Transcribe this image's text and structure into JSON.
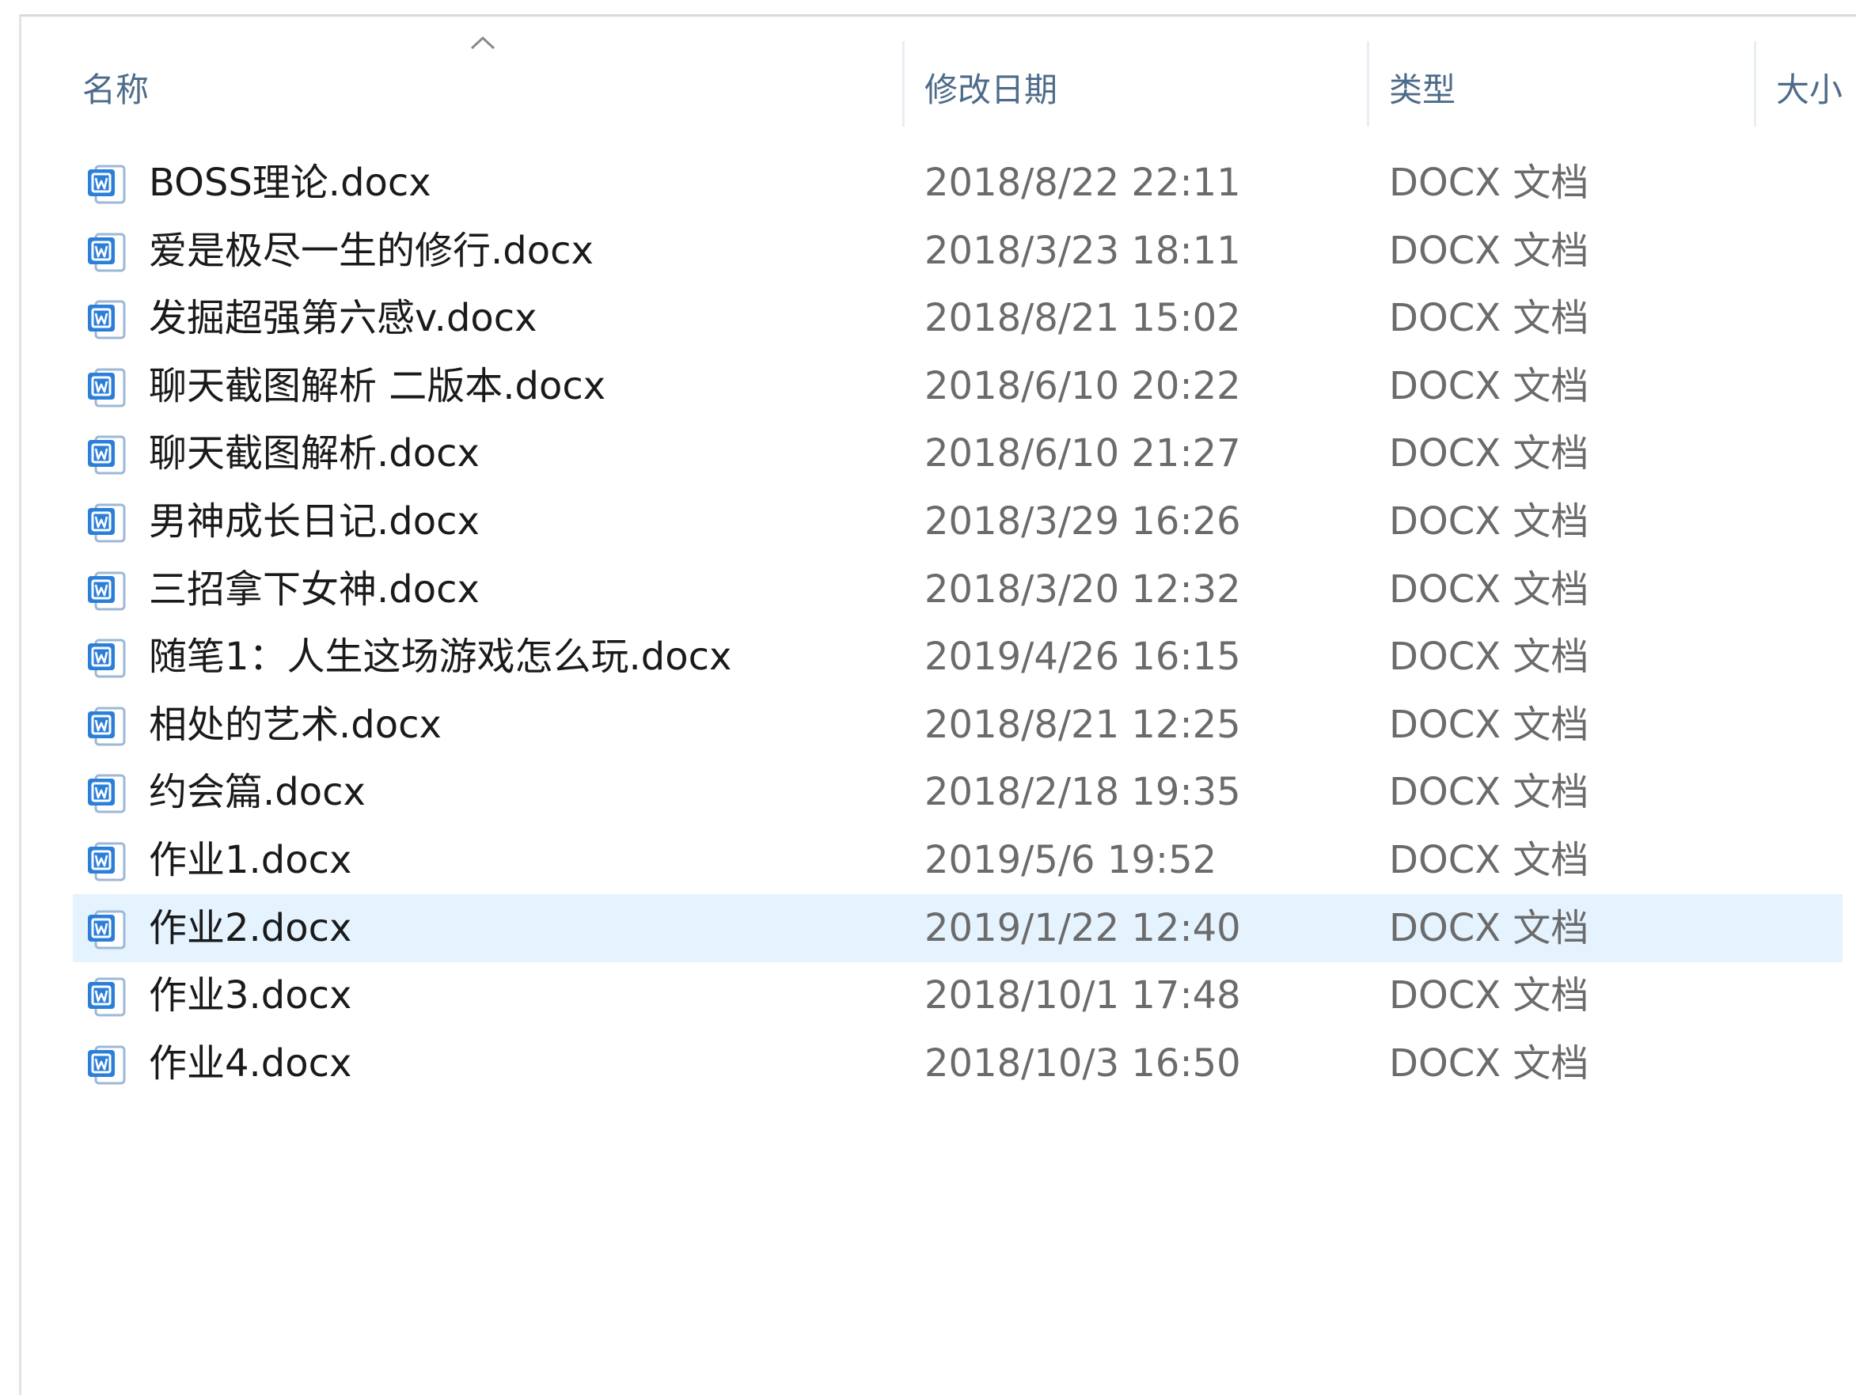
{
  "colors": {
    "header_text": "#4d6b8a",
    "name_text": "#1a1a1a",
    "meta_text": "#6b6b6b",
    "selection": "#e5f3ff",
    "doc_icon_blue": "#2b7fd9"
  },
  "header": {
    "sort_indicator": "chevron-up-icon",
    "columns": [
      {
        "key": "name",
        "label": "名称"
      },
      {
        "key": "date",
        "label": "修改日期"
      },
      {
        "key": "type",
        "label": "类型"
      },
      {
        "key": "size",
        "label": "大小"
      }
    ]
  },
  "files": [
    {
      "name": "BOSS理论.docx",
      "date": "2018/8/22 22:11",
      "type": "DOCX 文档",
      "icon": "word-doc-icon",
      "selected": false
    },
    {
      "name": "爱是极尽一生的修行.docx",
      "date": "2018/3/23 18:11",
      "type": "DOCX 文档",
      "icon": "word-doc-icon",
      "selected": false
    },
    {
      "name": "发掘超强第六感v.docx",
      "date": "2018/8/21 15:02",
      "type": "DOCX 文档",
      "icon": "word-doc-icon",
      "selected": false
    },
    {
      "name": "聊天截图解析 二版本.docx",
      "date": "2018/6/10 20:22",
      "type": "DOCX 文档",
      "icon": "word-doc-icon",
      "selected": false
    },
    {
      "name": "聊天截图解析.docx",
      "date": "2018/6/10 21:27",
      "type": "DOCX 文档",
      "icon": "word-doc-icon",
      "selected": false
    },
    {
      "name": "男神成长日记.docx",
      "date": "2018/3/29 16:26",
      "type": "DOCX 文档",
      "icon": "word-doc-icon",
      "selected": false
    },
    {
      "name": "三招拿下女神.docx",
      "date": "2018/3/20 12:32",
      "type": "DOCX 文档",
      "icon": "word-doc-icon",
      "selected": false
    },
    {
      "name": "随笔1：人生这场游戏怎么玩.docx",
      "date": "2019/4/26 16:15",
      "type": "DOCX 文档",
      "icon": "word-doc-icon",
      "selected": false
    },
    {
      "name": "相处的艺术.docx",
      "date": "2018/8/21 12:25",
      "type": "DOCX 文档",
      "icon": "word-doc-icon",
      "selected": false
    },
    {
      "name": "约会篇.docx",
      "date": "2018/2/18 19:35",
      "type": "DOCX 文档",
      "icon": "word-doc-icon",
      "selected": false
    },
    {
      "name": "作业1.docx",
      "date": "2019/5/6 19:52",
      "type": "DOCX 文档",
      "icon": "word-doc-icon",
      "selected": false
    },
    {
      "name": "作业2.docx",
      "date": "2019/1/22 12:40",
      "type": "DOCX 文档",
      "icon": "word-doc-icon",
      "selected": true
    },
    {
      "name": "作业3.docx",
      "date": "2018/10/1 17:48",
      "type": "DOCX 文档",
      "icon": "word-doc-icon",
      "selected": false
    },
    {
      "name": "作业4.docx",
      "date": "2018/10/3 16:50",
      "type": "DOCX 文档",
      "icon": "word-doc-icon",
      "selected": false
    }
  ]
}
